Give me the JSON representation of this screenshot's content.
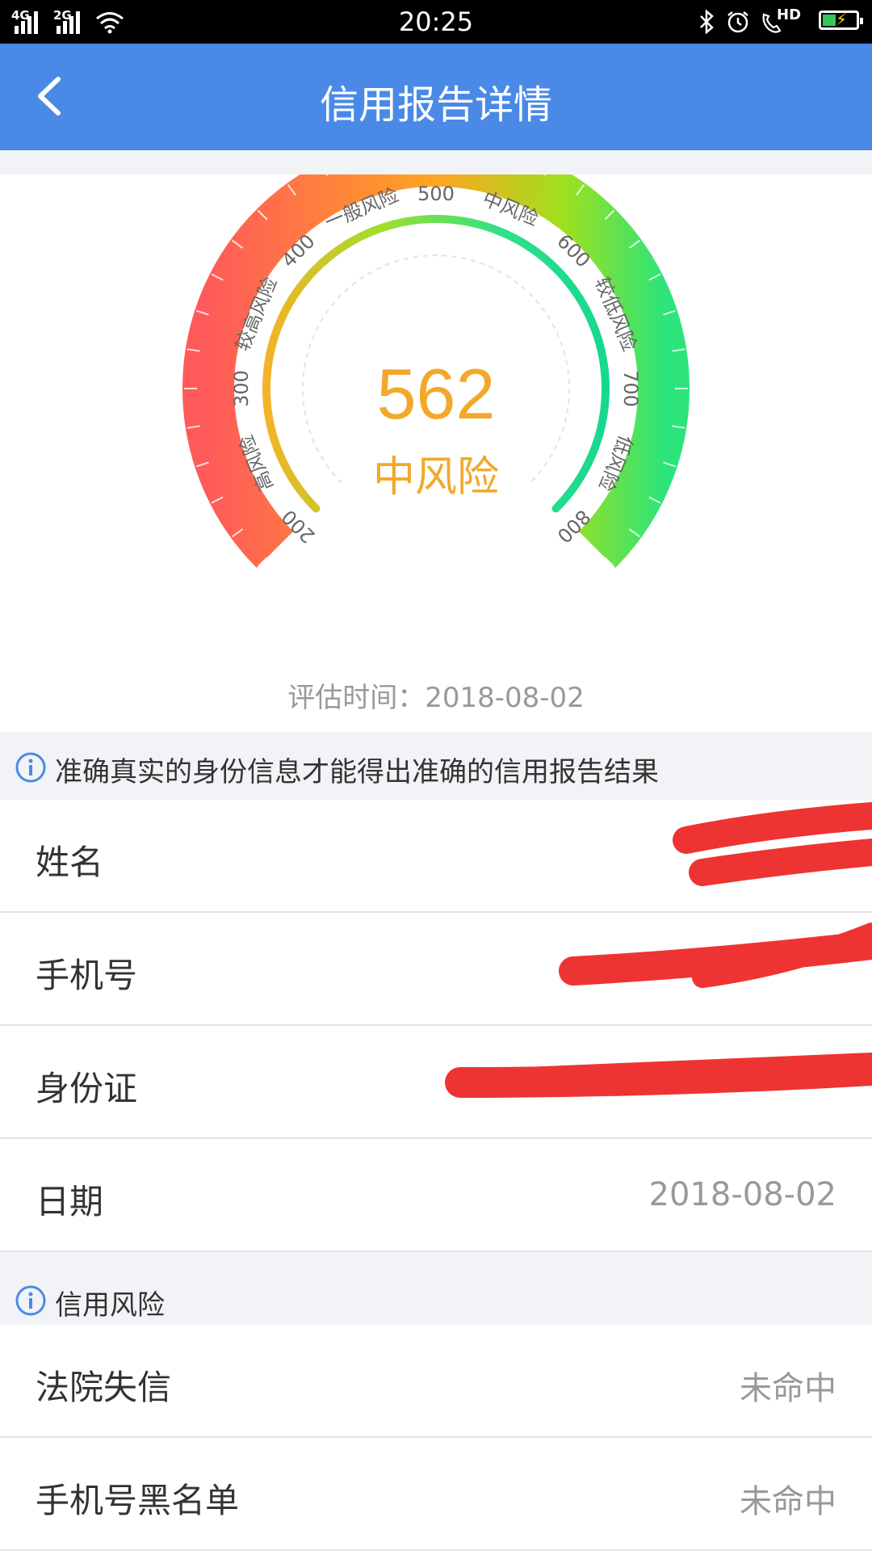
{
  "status_bar": {
    "time": "20:25",
    "signal_1": "4G",
    "signal_2": "2G",
    "hd": "HD",
    "icons": [
      "signal-icon",
      "wifi-icon",
      "bluetooth-icon",
      "alarm-icon",
      "call-hd-icon",
      "battery-charging-icon"
    ]
  },
  "header": {
    "title": "信用报告详情",
    "back_icon": "chevron-left-icon"
  },
  "score_gauge": {
    "score": "562",
    "level": "中风险",
    "score_color": "#f3a82a",
    "eval_time": "评估时间：2018-08-02",
    "range": [
      200,
      800
    ],
    "score_value": 562,
    "tick_labels": [
      "200",
      "300",
      "400",
      "500",
      "600",
      "700",
      "800"
    ],
    "zone_labels": [
      "高风险",
      "较高风险",
      "一般风险",
      "中风险",
      "较低风险",
      "低风险"
    ],
    "colors": {
      "red": "#ff5a5a",
      "orange": "#ffa521",
      "green": "#3ee07a"
    }
  },
  "identity_notice": "准确真实的身份信息才能得出准确的信用报告结果",
  "identity_rows": [
    {
      "label": "姓名",
      "value": ""
    },
    {
      "label": "手机号",
      "value": ""
    },
    {
      "label": "身份证",
      "value": ""
    },
    {
      "label": "日期",
      "value": "2018-08-02"
    }
  ],
  "risk_notice": "信用风险",
  "risk_rows": [
    {
      "label": "法院失信",
      "value": "未命中"
    },
    {
      "label": "手机号黑名单",
      "value": "未命中"
    }
  ],
  "accent_color": "#4a8ae6"
}
